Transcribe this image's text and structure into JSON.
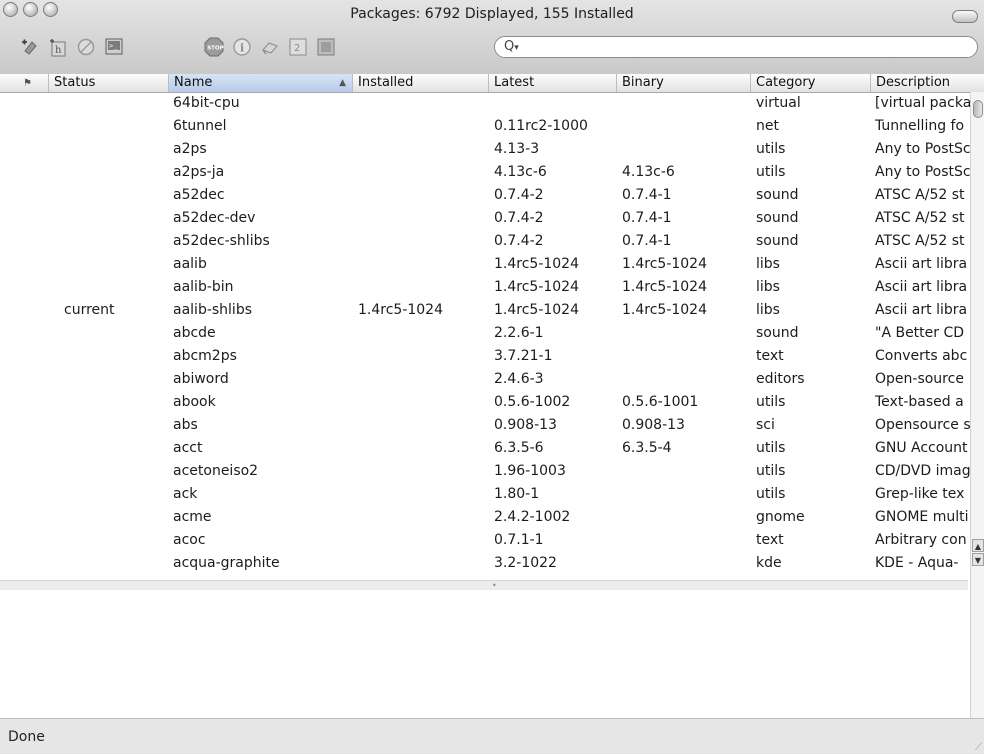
{
  "window": {
    "title": "Packages: 6792 Displayed, 155 Installed"
  },
  "toolbar": {
    "buttons": [
      {
        "icon": "install-binary-icon"
      },
      {
        "icon": "install-source-icon"
      },
      {
        "icon": "remove-icon"
      },
      {
        "icon": "terminal-icon"
      },
      {
        "icon": "stop-icon",
        "label": "STOP"
      },
      {
        "icon": "info-icon",
        "label": "i"
      },
      {
        "icon": "feedback-icon"
      },
      {
        "icon": "split-view-icon"
      },
      {
        "icon": "table-icon"
      }
    ]
  },
  "search": {
    "value": "",
    "placeholder": ""
  },
  "table": {
    "columns": [
      "",
      "Status",
      "Name",
      "Installed",
      "Latest",
      "Binary",
      "Category",
      "Description"
    ],
    "sorted_column": "Name",
    "rows": [
      {
        "status": "",
        "name": "64bit-cpu",
        "installed": "",
        "latest": "",
        "binary": "",
        "category": "virtual",
        "description": "[virtual packa"
      },
      {
        "status": "",
        "name": "6tunnel",
        "installed": "",
        "latest": "0.11rc2-1000",
        "binary": "",
        "category": "net",
        "description": "Tunnelling fo"
      },
      {
        "status": "",
        "name": "a2ps",
        "installed": "",
        "latest": "4.13-3",
        "binary": "",
        "category": "utils",
        "description": "Any to PostSc"
      },
      {
        "status": "",
        "name": "a2ps-ja",
        "installed": "",
        "latest": "4.13c-6",
        "binary": "4.13c-6",
        "category": "utils",
        "description": "Any to PostSc"
      },
      {
        "status": "",
        "name": "a52dec",
        "installed": "",
        "latest": "0.7.4-2",
        "binary": "0.7.4-1",
        "category": "sound",
        "description": "ATSC A/52 st"
      },
      {
        "status": "",
        "name": "a52dec-dev",
        "installed": "",
        "latest": "0.7.4-2",
        "binary": "0.7.4-1",
        "category": "sound",
        "description": "ATSC A/52 st"
      },
      {
        "status": "",
        "name": "a52dec-shlibs",
        "installed": "",
        "latest": "0.7.4-2",
        "binary": "0.7.4-1",
        "category": "sound",
        "description": "ATSC A/52 st"
      },
      {
        "status": "",
        "name": "aalib",
        "installed": "",
        "latest": "1.4rc5-1024",
        "binary": "1.4rc5-1024",
        "category": "libs",
        "description": "Ascii art libra"
      },
      {
        "status": "",
        "name": "aalib-bin",
        "installed": "",
        "latest": "1.4rc5-1024",
        "binary": "1.4rc5-1024",
        "category": "libs",
        "description": "Ascii art libra"
      },
      {
        "status": "current",
        "name": "aalib-shlibs",
        "installed": "1.4rc5-1024",
        "latest": "1.4rc5-1024",
        "binary": "1.4rc5-1024",
        "category": "libs",
        "description": "Ascii art libra"
      },
      {
        "status": "",
        "name": "abcde",
        "installed": "",
        "latest": "2.2.6-1",
        "binary": "",
        "category": "sound",
        "description": "\"A Better CD"
      },
      {
        "status": "",
        "name": "abcm2ps",
        "installed": "",
        "latest": "3.7.21-1",
        "binary": "",
        "category": "text",
        "description": "Converts abc"
      },
      {
        "status": "",
        "name": "abiword",
        "installed": "",
        "latest": "2.4.6-3",
        "binary": "",
        "category": "editors",
        "description": "Open-source"
      },
      {
        "status": "",
        "name": "abook",
        "installed": "",
        "latest": "0.5.6-1002",
        "binary": "0.5.6-1001",
        "category": "utils",
        "description": "Text-based a"
      },
      {
        "status": "",
        "name": "abs",
        "installed": "",
        "latest": "0.908-13",
        "binary": "0.908-13",
        "category": "sci",
        "description": "Opensource s"
      },
      {
        "status": "",
        "name": "acct",
        "installed": "",
        "latest": "6.3.5-6",
        "binary": "6.3.5-4",
        "category": "utils",
        "description": "GNU Account"
      },
      {
        "status": "",
        "name": "acetoneiso2",
        "installed": "",
        "latest": "1.96-1003",
        "binary": "",
        "category": "utils",
        "description": "CD/DVD imag"
      },
      {
        "status": "",
        "name": "ack",
        "installed": "",
        "latest": "1.80-1",
        "binary": "",
        "category": "utils",
        "description": "Grep-like tex"
      },
      {
        "status": "",
        "name": "acme",
        "installed": "",
        "latest": "2.4.2-1002",
        "binary": "",
        "category": "gnome",
        "description": "GNOME multi"
      },
      {
        "status": "",
        "name": "acoc",
        "installed": "",
        "latest": "0.7.1-1",
        "binary": "",
        "category": "text",
        "description": "Arbitrary con"
      },
      {
        "status": "",
        "name": "acqua-graphite",
        "installed": "",
        "latest": "3.2-1022",
        "binary": "",
        "category": "kde",
        "description": "KDE - Aqua-"
      }
    ]
  },
  "statusbar": {
    "text": "Done"
  }
}
